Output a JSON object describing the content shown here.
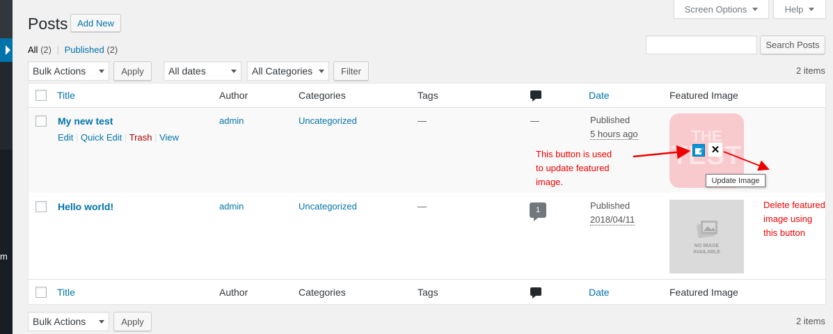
{
  "sidebar": {
    "partial_label": "m"
  },
  "page": {
    "title": "Posts",
    "add_new": "Add New"
  },
  "header_tabs": {
    "screen_options": "Screen Options",
    "help": "Help"
  },
  "views": {
    "all": "All",
    "all_count": "(2)",
    "sep": "|",
    "published": "Published",
    "published_count": "(2)"
  },
  "search": {
    "button": "Search Posts",
    "value": ""
  },
  "top_nav": {
    "bulk_actions": "Bulk Actions",
    "apply": "Apply",
    "dates": "All dates",
    "categories": "All Categories",
    "filter": "Filter",
    "items": "2 items"
  },
  "bottom_nav": {
    "bulk_actions": "Bulk Actions",
    "apply": "Apply",
    "items": "2 items"
  },
  "columns": {
    "title": "Title",
    "author": "Author",
    "categories": "Categories",
    "tags": "Tags",
    "date": "Date",
    "featured": "Featured Image"
  },
  "rows": [
    {
      "title": "My new test",
      "actions": {
        "edit": "Edit",
        "quick_edit": "Quick Edit",
        "trash": "Trash",
        "view": "View",
        "sep": "|"
      },
      "author": "admin",
      "category": "Uncategorized",
      "tags": "—",
      "comments": "—",
      "status": "Published",
      "date": "5 hours ago",
      "thumb_text_1": "THE",
      "thumb_text_2": "TEST"
    },
    {
      "title": "Hello world!",
      "author": "admin",
      "category": "Uncategorized",
      "tags": "—",
      "comments": "1",
      "status": "Published",
      "date": "2018/04/11",
      "thumb_text_1": "NO IMAGE",
      "thumb_text_2": "AVAILABLE"
    }
  ],
  "annotations": {
    "update_note": [
      "This button is used",
      "to update featured",
      "image."
    ],
    "delete_note": [
      "Delete featured",
      "image using",
      "this button"
    ],
    "tooltip": "Update Image"
  },
  "colors": {
    "link": "#0073aa",
    "trash": "#a00",
    "annotation": "#e00"
  }
}
